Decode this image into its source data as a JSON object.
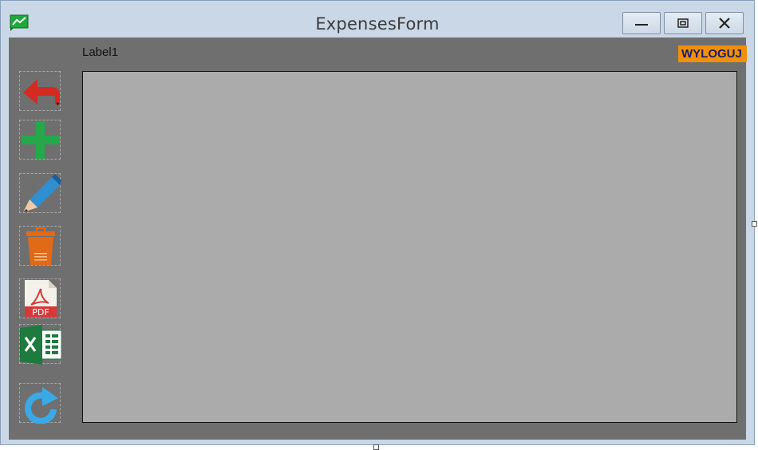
{
  "window": {
    "title": "ExpensesForm",
    "app_icon": "green-chart-icon",
    "controls": [
      "minimize-icon",
      "maximize-icon",
      "close-icon"
    ]
  },
  "form": {
    "label1": "Label1",
    "logout_label": "WYLOGUJ"
  },
  "toolbar": {
    "items": [
      {
        "icon": "back-arrow-icon",
        "color": "#d42a22"
      },
      {
        "icon": "add-icon",
        "color": "#25a84a"
      },
      {
        "icon": "edit-pencil-icon",
        "color": "#2f8fd0"
      },
      {
        "icon": "trash-icon",
        "color": "#e06a18"
      },
      {
        "icon": "pdf-icon",
        "color": "#d43a3a"
      },
      {
        "icon": "excel-icon",
        "color": "#1e7a3e"
      },
      {
        "icon": "refresh-icon",
        "color": "#3aa9e6"
      }
    ]
  },
  "colors": {
    "client_bg": "#6f6f6f",
    "grid_bg": "#ababab",
    "logout_bg": "#f0900a",
    "logout_text": "#1b1b6b"
  }
}
